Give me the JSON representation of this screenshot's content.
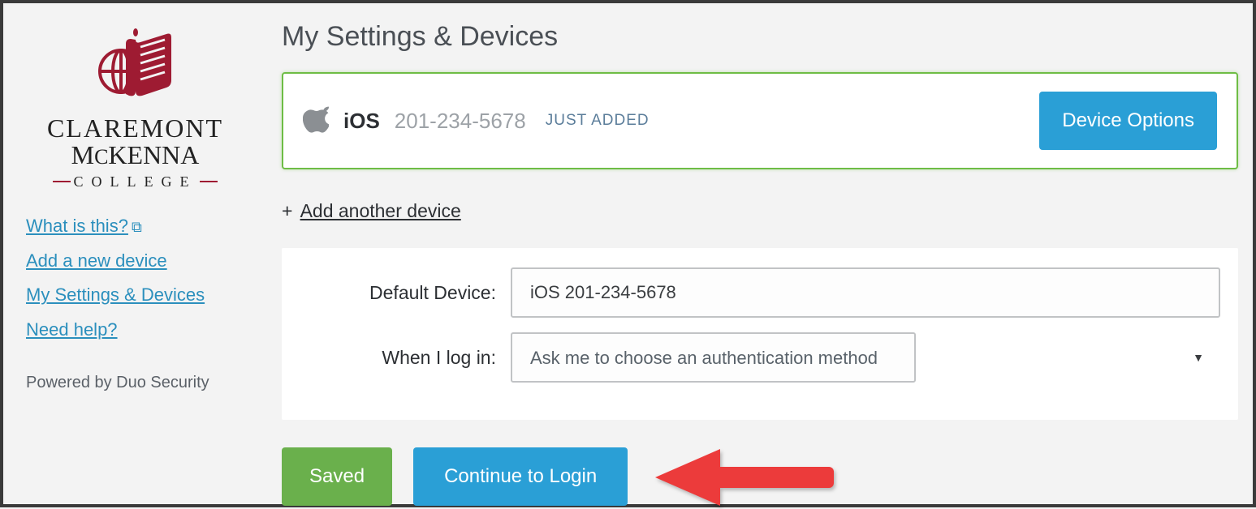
{
  "sidebar": {
    "org_line1": "CLAREMONT",
    "org_line2_pre": "M",
    "org_line2_small": "C",
    "org_line2_post": "KENNA",
    "org_sub": "COLLEGE",
    "links": {
      "what": "What is this?",
      "add": "Add a new device",
      "settings": "My Settings & Devices",
      "help": "Need help?"
    },
    "powered": "Powered by Duo Security"
  },
  "page": {
    "title": "My Settings & Devices"
  },
  "device": {
    "os": "iOS",
    "number": "201-234-5678",
    "badge": "JUST ADDED",
    "options_btn": "Device Options"
  },
  "add_another": {
    "plus": "+",
    "label": "Add another device"
  },
  "form": {
    "default_label": "Default Device:",
    "default_value": "iOS 201-234-5678",
    "login_label": "When I log in:",
    "login_value": "Ask me to choose an authentication method"
  },
  "buttons": {
    "saved": "Saved",
    "continue": "Continue to Login"
  }
}
